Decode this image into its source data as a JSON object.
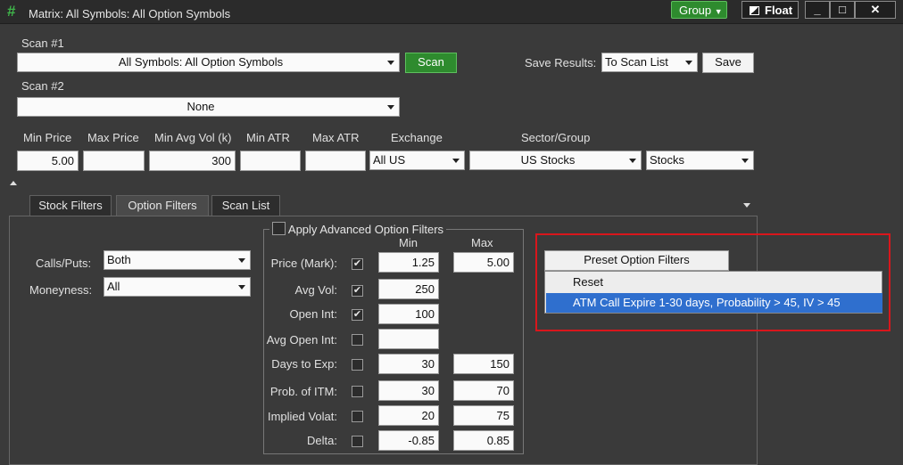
{
  "window": {
    "title": "Matrix: All Symbols: All Option Symbols",
    "group_label": "Group",
    "float_label": "Float",
    "minimize_icon": "_",
    "maximize_icon": "□",
    "close_icon": "✕"
  },
  "scan1": {
    "label": "Scan #1",
    "value": "All Symbols: All Option Symbols",
    "scan_button": "Scan"
  },
  "scan2": {
    "label": "Scan #2",
    "value": "None"
  },
  "save": {
    "label": "Save Results:",
    "value": "To Scan List",
    "button": "Save"
  },
  "filters": {
    "headers": [
      "Min Price",
      "Max Price",
      "Min Avg Vol (k)",
      "Min ATR",
      "Max ATR",
      "Exchange",
      "Sector/Group"
    ],
    "min_price": "5.00",
    "max_price": "",
    "min_avg_vol": "300",
    "min_atr": "",
    "max_atr": "",
    "exchange": "All US",
    "sector": "US Stocks",
    "group": "Stocks"
  },
  "tabs": [
    "Stock Filters",
    "Option Filters",
    "Scan List"
  ],
  "option": {
    "calls_puts_label": "Calls/Puts:",
    "calls_puts_value": "Both",
    "moneyness_label": "Moneyness:",
    "moneyness_value": "All",
    "advanced_label": "Apply Advanced Option Filters",
    "min_header": "Min",
    "max_header": "Max",
    "rows": [
      {
        "label": "Price (Mark):",
        "checked": "✔",
        "min": "1.25",
        "max": "5.00"
      },
      {
        "label": "Avg Vol:",
        "checked": "✔",
        "min": "250",
        "max": ""
      },
      {
        "label": "Open Int:",
        "checked": "✔",
        "min": "100",
        "max": ""
      },
      {
        "label": "Avg Open Int:",
        "checked": "",
        "min": "",
        "max": ""
      },
      {
        "label": "Days to Exp:",
        "checked": "",
        "min": "30",
        "max": "150"
      },
      {
        "label": "Prob. of ITM:",
        "checked": "",
        "min": "30",
        "max": "70"
      },
      {
        "label": "Implied Volat:",
        "checked": "",
        "min": "20",
        "max": "75"
      },
      {
        "label": "Delta:",
        "checked": "",
        "min": "-0.85",
        "max": "0.85"
      }
    ]
  },
  "preset": {
    "button": "Preset Option Filters",
    "items": [
      "Reset",
      "ATM Call Expire 1-30 days, Probability > 45, IV > 45"
    ]
  },
  "colors": {
    "accent_green": "#2e8b2e",
    "highlight": "#d9161c",
    "selection": "#2f6fce"
  }
}
